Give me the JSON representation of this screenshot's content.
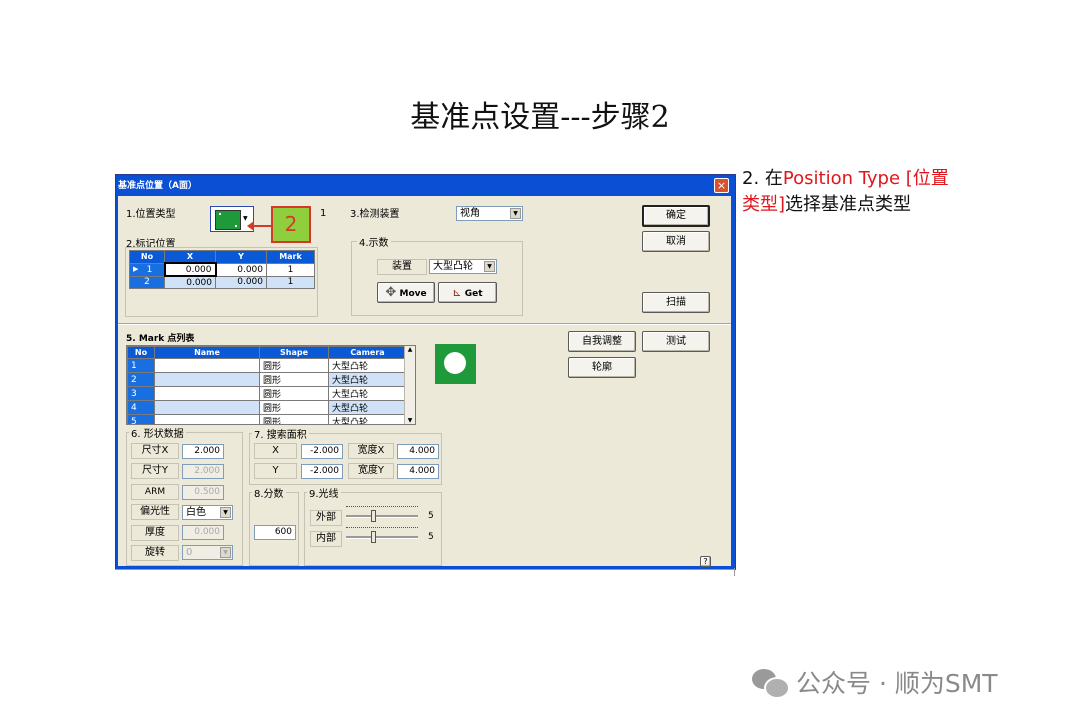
{
  "slide": {
    "title": "基准点设置---步骤2",
    "note_prefix": "2. 在",
    "note_red": "Position Type [位置类型]",
    "note_suffix": "选择基准点类型",
    "watermark": "公众号 · 顺为SMT",
    "callout_number": "2"
  },
  "dialog": {
    "title": "基准点位置（A面）",
    "close_glyph": "×",
    "help_glyph": "?",
    "position_type_label": "1.位置类型",
    "position_value": "1",
    "mark_position_label": "2.标记位置",
    "mark_table": {
      "headers": [
        "No",
        "X",
        "Y",
        "Mark"
      ],
      "rows": [
        {
          "no": "1",
          "x": "0.000",
          "y": "0.000",
          "mark": "1"
        },
        {
          "no": "2",
          "x": "0.000",
          "y": "0.000",
          "mark": "1"
        }
      ]
    },
    "detect_label": "3.检测装置",
    "detect_value": "视角",
    "teach_label": "4.示数",
    "device_label": "装置",
    "device_value": "大型凸轮",
    "move_label": "Move",
    "get_label": "Get",
    "ok_label": "确定",
    "cancel_label": "取消",
    "scan_label": "扫描",
    "mark_list_label": "5. Mark 点列表",
    "mark_list": {
      "headers": [
        "No",
        "Name",
        "Shape",
        "Camera"
      ],
      "rows": [
        {
          "no": "1",
          "name": "",
          "shape": "圆形",
          "camera": "大型凸轮"
        },
        {
          "no": "2",
          "name": "",
          "shape": "圆形",
          "camera": "大型凸轮"
        },
        {
          "no": "3",
          "name": "",
          "shape": "圆形",
          "camera": "大型凸轮"
        },
        {
          "no": "4",
          "name": "",
          "shape": "圆形",
          "camera": "大型凸轮"
        },
        {
          "no": "5",
          "name": "",
          "shape": "圆形",
          "camera": "大型凸轮"
        }
      ]
    },
    "self_adjust_label": "自我调整",
    "test_label": "测试",
    "contour_label": "轮廓",
    "shape_data_label": "6. 形状数据",
    "size_x_label": "尺寸X",
    "size_x_value": "2.000",
    "size_y_label": "尺寸Y",
    "size_y_value": "2.000",
    "arm_label": "ARM",
    "arm_value": "0.500",
    "polarity_label": "偏光性",
    "polarity_value": "白色",
    "thickness_label": "厚度",
    "thickness_value": "0.000",
    "rotation_label": "旋转",
    "rotation_value": "0",
    "search_area_label": "7. 搜索面积",
    "sa_x_label": "X",
    "sa_x_value": "-2.000",
    "sa_width_x_label": "宽度X",
    "sa_width_x_value": "4.000",
    "sa_y_label": "Y",
    "sa_y_value": "-2.000",
    "sa_width_y_label": "宽度Y",
    "sa_width_y_value": "4.000",
    "score_label": "8.分数",
    "score_value": "600",
    "light_label": "9.光线",
    "outer_label": "外部",
    "outer_value": "5",
    "inner_label": "内部",
    "inner_value": "5"
  },
  "colors": {
    "title_bar": "#0a4fd4",
    "dialog_body": "#ece9d8",
    "accent_red": "#e0161c",
    "preview_green": "#1f9a3a"
  }
}
